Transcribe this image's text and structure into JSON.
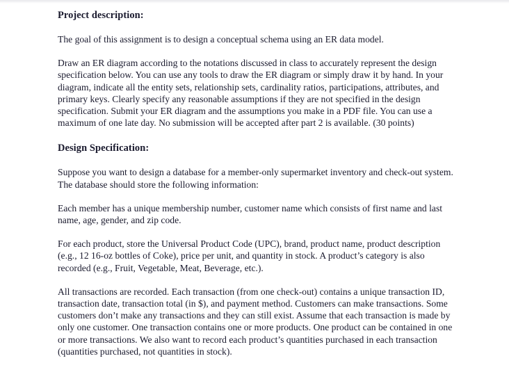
{
  "document": {
    "background_color": "#ffffff",
    "text_color": "#1a1a2e",
    "blocks": [
      {
        "type": "heading",
        "name": "project-description-heading",
        "text": "Project description:"
      },
      {
        "type": "paragraph",
        "name": "goal-paragraph",
        "text": "The goal of this assignment is to design a conceptual schema using an ER data model."
      },
      {
        "type": "paragraph",
        "name": "er-diagram-instructions-paragraph",
        "text": "Draw an ER diagram according to the notations discussed in class to accurately represent the design specification below. You can use any tools to draw the ER diagram or simply draw it by hand. In your diagram, indicate all the entity sets, relationship sets, cardinality ratios, participations, attributes, and primary keys. Clearly specify any reasonable assumptions if they are not specified in the design specification. Submit your ER diagram and the assumptions you make in a PDF file. You can use a maximum of one late day. No submission will be accepted after part 2 is available. (30 points)"
      },
      {
        "type": "heading",
        "name": "design-specification-heading",
        "text": "Design Specification:"
      },
      {
        "type": "paragraph",
        "name": "database-overview-paragraph",
        "text": "Suppose you want to design a database for a member-only supermarket inventory and check-out system. The database should store the following information:"
      },
      {
        "type": "paragraph",
        "name": "member-requirements-paragraph",
        "text": "Each member has a unique membership number, customer name which consists of first name and last name, age, gender, and zip code."
      },
      {
        "type": "paragraph",
        "name": "product-requirements-paragraph",
        "text": "For each product, store the Universal Product Code (UPC), brand, product name, product description (e.g., 12 16-oz bottles of Coke), price per unit, and quantity in stock. A product’s category is also recorded (e.g., Fruit, Vegetable, Meat, Beverage, etc.)."
      },
      {
        "type": "paragraph",
        "name": "transaction-requirements-paragraph",
        "text": "All transactions are recorded. Each transaction (from one check-out) contains a unique transaction ID, transaction date, transaction total (in $), and payment method. Customers can make transactions. Some customers don’t make any transactions and they can still exist. Assume that each transaction is made by only one customer. One transaction contains one or more products. One product can be contained in one or more transactions. We also want to record each product’s quantities purchased in each transaction (quantities purchased, not quantities in stock)."
      }
    ]
  }
}
